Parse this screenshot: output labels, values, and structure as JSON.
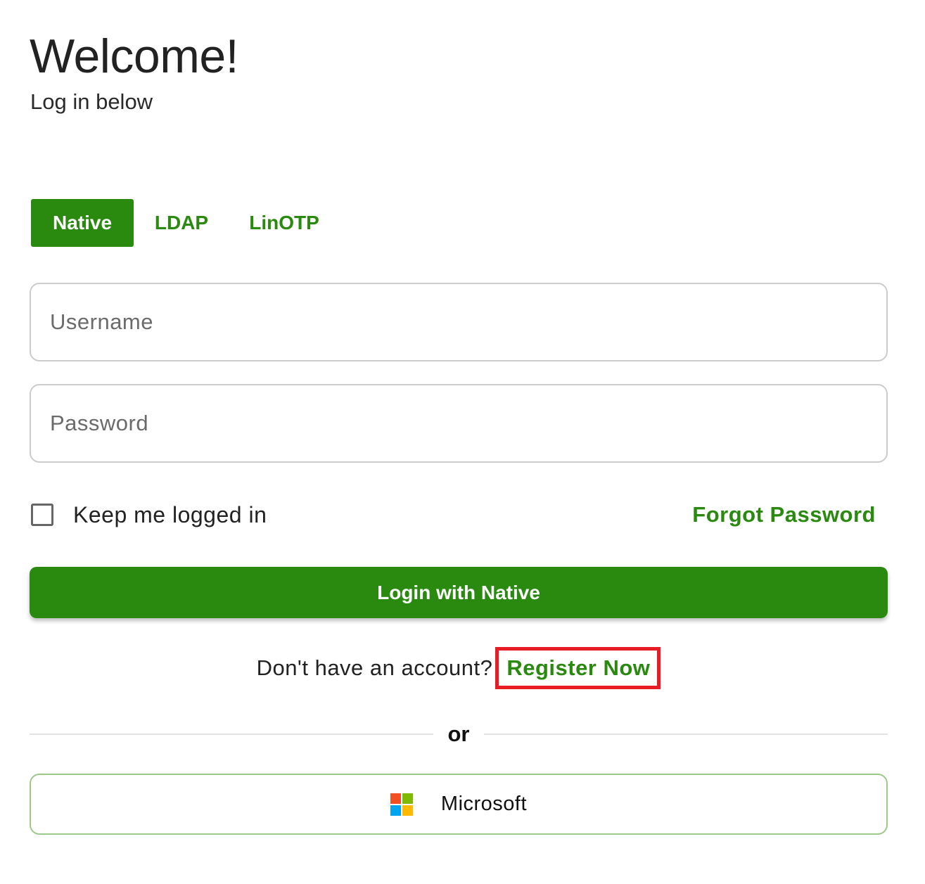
{
  "header": {
    "title": "Welcome!",
    "subtitle": "Log in below"
  },
  "tabs": [
    {
      "label": "Native",
      "active": true
    },
    {
      "label": "LDAP",
      "active": false
    },
    {
      "label": "LinOTP",
      "active": false
    }
  ],
  "form": {
    "username_placeholder": "Username",
    "username_value": "",
    "password_placeholder": "Password",
    "password_value": "",
    "remember_label": "Keep me logged in",
    "remember_checked": false,
    "forgot_label": "Forgot Password",
    "login_label": "Login with Native"
  },
  "register": {
    "prompt": "Don't have an account?",
    "link_label": "Register Now",
    "highlight_color": "#e81c24"
  },
  "divider": {
    "label": "or"
  },
  "sso": {
    "microsoft_label": "Microsoft",
    "icon": "microsoft-logo-icon",
    "logo_colors": [
      "#f25022",
      "#7fba00",
      "#00a4ef",
      "#ffb900"
    ]
  },
  "colors": {
    "accent": "#2a8a10",
    "text": "#222222",
    "border": "#cccccc"
  }
}
